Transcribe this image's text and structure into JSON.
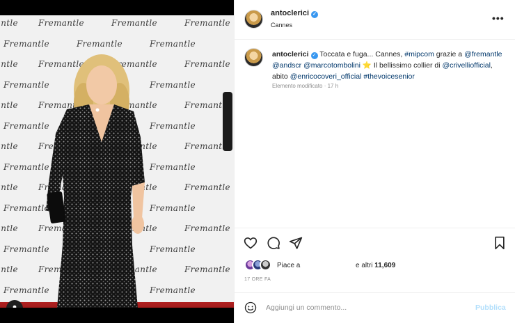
{
  "media": {
    "watermark_text": "Fremantle"
  },
  "header": {
    "username": "antoclerici",
    "location": "Cannes",
    "more_icon": "more-horizontal-icon"
  },
  "caption": {
    "username": "antoclerici",
    "text_1": "Toccata e fuga... Cannes,",
    "hashtag_1": "#mipcom",
    "text_2": "grazie a",
    "mention_1": "@fremantle",
    "mention_2": "@andscr",
    "mention_3": "@marcotombolini",
    "star": "⭐",
    "text_3": "Il bellissimo collier di",
    "mention_4": "@crivelliofficial",
    "text_4": ", abito",
    "mention_5": "@enricocoveri_official",
    "hashtag_2": "#thevoicesenior",
    "edited_label": "Elemento modificato",
    "edited_time": "17 h"
  },
  "actions": {
    "like_icon": "heart-icon",
    "comment_icon": "comment-icon",
    "share_icon": "share-icon",
    "save_icon": "bookmark-icon"
  },
  "likes": {
    "prefix": "Piace a",
    "suffix": "e altri",
    "count": "11,609"
  },
  "time_ago": "17 ORE FA",
  "comment": {
    "placeholder": "Aggiungi un commento...",
    "post_label": "Pubblica"
  },
  "colors": {
    "link": "#00376b",
    "verified": "#3897f0",
    "post_disabled": "#b2dffc",
    "carpet": "#b02020"
  }
}
